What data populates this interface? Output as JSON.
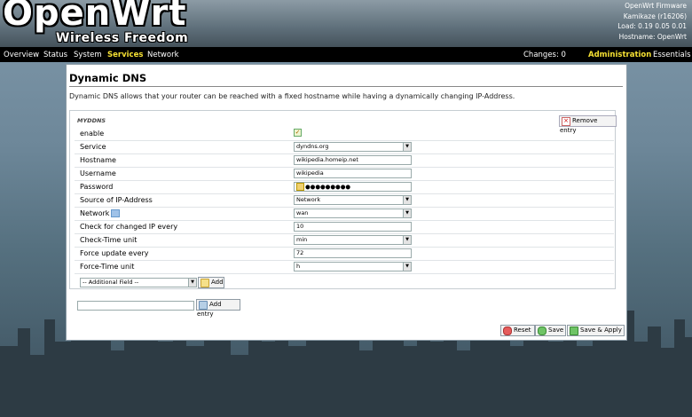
{
  "header": {
    "logo": "OpenWrt",
    "tagline": "Wireless Freedom",
    "sysinfo": [
      "OpenWrt Firmware",
      "Kamikaze (r16206)",
      "Load: 0.19 0.05 0.01",
      "Hostname: OpenWrt"
    ]
  },
  "menu": {
    "left": [
      "Overview",
      "Status",
      "System",
      "Services",
      "Network"
    ],
    "active": "Services",
    "changes": "Changes: 0",
    "administration": "Administration",
    "essentials": "Essentials"
  },
  "page": {
    "title": "Dynamic DNS",
    "description": "Dynamic DNS allows that your router can be reached with a fixed hostname while having a dynamically changing IP-Address.",
    "section_name": "MYDDNS",
    "remove_label": "Remove entry"
  },
  "form": {
    "enable_label": "enable",
    "enable_checked": true,
    "service_label": "Service",
    "service_value": "dyndns.org",
    "hostname_label": "Hostname",
    "hostname_value": "wikipedia.homeip.net",
    "username_label": "Username",
    "username_value": "wikipedia",
    "password_label": "Password",
    "password_value": "●●●●●●●●●",
    "source_label": "Source of IP-Address",
    "source_value": "Network",
    "network_label": "Network",
    "network_value": "wan",
    "check_label": "Check for changed IP every",
    "check_value": "10",
    "check_unit_label": "Check-Time unit",
    "check_unit_value": "min",
    "force_label": "Force update every",
    "force_value": "72",
    "force_unit_label": "Force-Time unit",
    "force_unit_value": "h",
    "additional_field": "-- Additional Field --",
    "add_label": "Add",
    "add_entry_label": "Add entry"
  },
  "actions": {
    "reset": "Reset",
    "save": "Save",
    "save_apply": "Save & Apply"
  }
}
